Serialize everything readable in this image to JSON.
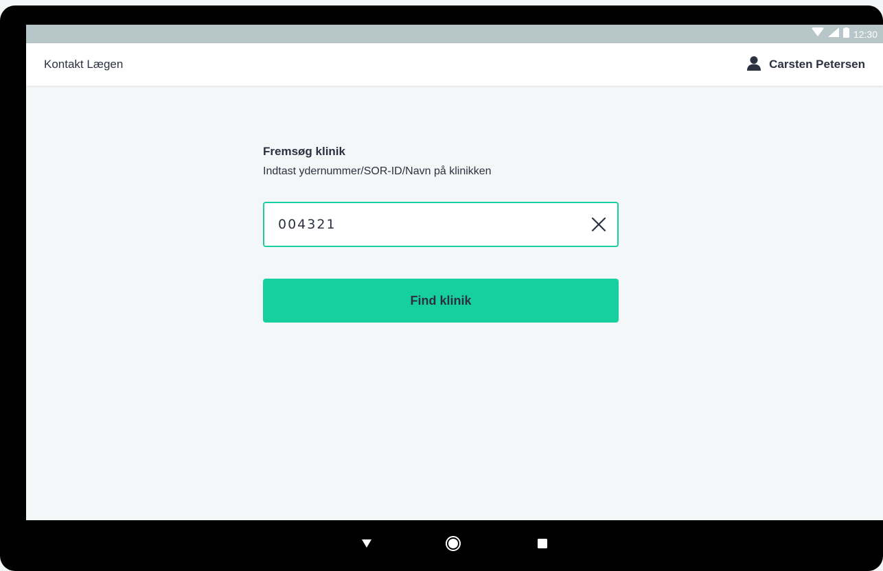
{
  "status_bar": {
    "time": "12:30",
    "icons": [
      "wifi-icon",
      "signal-icon",
      "battery-icon"
    ]
  },
  "app_bar": {
    "title": "Kontakt Lægen",
    "user_name": "Carsten Petersen",
    "user_icon": "person-icon"
  },
  "form": {
    "title": "Fremsøg klinik",
    "subtitle": "Indtast ydernummer/SOR-ID/Navn på klinikken",
    "search_value": "004321",
    "clear_icon": "close-icon",
    "submit_label": "Find klinik"
  },
  "nav_bar": {
    "buttons": [
      "back-icon",
      "home-icon",
      "recents-icon"
    ]
  },
  "colors": {
    "accent": "#17d0a0",
    "input_border": "#19cf9f",
    "text": "#2c3140",
    "status_bar": "#b7c6c8",
    "background": "#f4f7f8"
  }
}
